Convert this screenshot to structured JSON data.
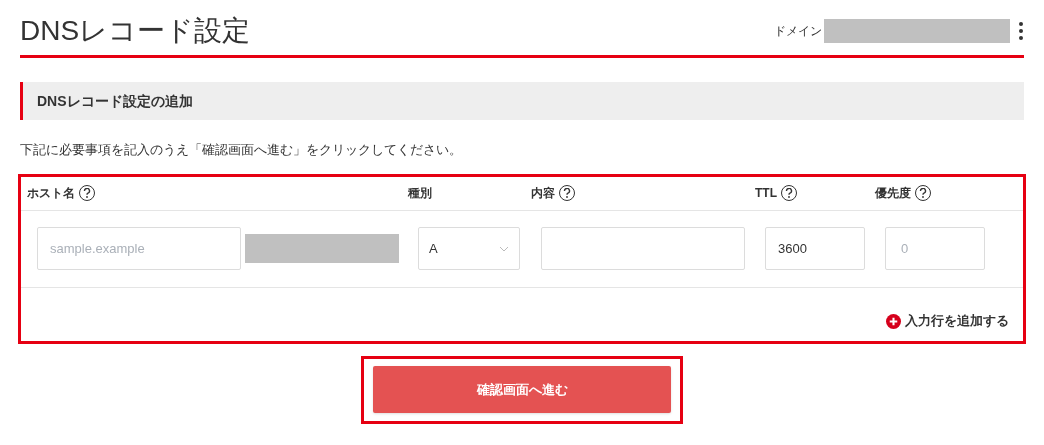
{
  "page_title": "DNSレコード設定",
  "domain": {
    "label": "ドメイン"
  },
  "section": {
    "title": "DNSレコード設定の追加"
  },
  "instruction": "下記に必要事項を記入のうえ「確認画面へ進む」をクリックしてください。",
  "columns": [
    {
      "label": "ホスト名",
      "help": true
    },
    {
      "label": "種別",
      "help": false
    },
    {
      "label": "内容",
      "help": true
    },
    {
      "label": "TTL",
      "help": true
    },
    {
      "label": "優先度",
      "help": true
    }
  ],
  "row": {
    "host": {
      "placeholder": "sample.example"
    },
    "type": {
      "value": "A"
    },
    "ttl": {
      "value": "3600"
    },
    "priority": {
      "placeholder": "0"
    }
  },
  "add_row": "入力行を追加する",
  "submit": "確認画面へ進む"
}
